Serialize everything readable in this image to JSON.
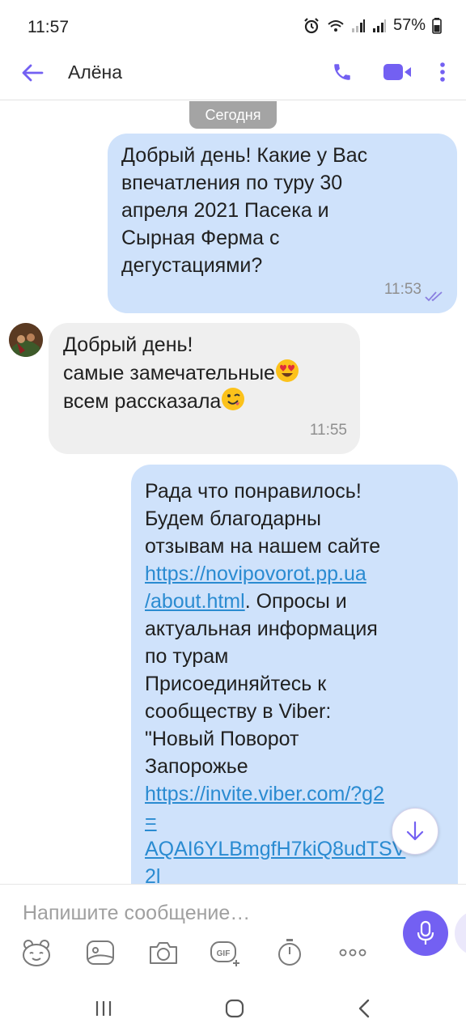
{
  "status_bar": {
    "time": "11:57",
    "battery": "57%",
    "icons": [
      "alarm-icon",
      "wifi-icon",
      "signal-icon",
      "signal-icon",
      "battery-icon"
    ]
  },
  "header": {
    "contact_name": "Алёна",
    "icons": [
      "back-arrow-icon",
      "phone-icon",
      "video-camera-icon",
      "more-vertical-icon"
    ]
  },
  "colors": {
    "accent": "#7360f2",
    "outgoing_bubble": "#cfe2fb",
    "incoming_bubble": "#efefef",
    "link": "#2a8bd1",
    "date_chip": "#a4a4a4"
  },
  "chat": {
    "date_label": "Сегодня",
    "messages": [
      {
        "direction": "outgoing",
        "text": "Добрый день! Какие у Вас\nвпечатления по туру 30\nапреля 2021 Пасека и\nСырная Ферма с\nдегустациями?",
        "time": "11:53",
        "status": "read"
      },
      {
        "direction": "incoming",
        "line1": "Добрый день!",
        "line2": "самые замечательные",
        "line3": "всем рассказала",
        "time": "11:55",
        "emojis": [
          "heart-eyes-emoji",
          "winking-face-emoji"
        ]
      },
      {
        "direction": "outgoing",
        "part1": "Рада что понравилось!\nБудем благодарны\nотзывам на нашем сайте\n",
        "link1": "https://novipovorot.pp.ua\n/about.html",
        "part2": ". Опросы и\nактуальная информация\nпо турам\n Присоединяйтесь к\nсообществу в Viber:\n\"Новый Поворот\nЗапорожье\n",
        "link2": "https://invite.viber.com/?g2\n=\nAQAI6YLBmgfH7kiQ8udTSV\n2l"
      }
    ]
  },
  "composer": {
    "placeholder": "Напишите сообщение…",
    "tools": [
      "sticker-icon",
      "doodle-icon",
      "camera-icon",
      "gif-icon",
      "timer-icon",
      "more-horizontal-icon"
    ],
    "send_icon": "microphone-icon"
  },
  "nav_bar": {
    "buttons": [
      "recent-apps-icon",
      "home-icon",
      "back-icon"
    ]
  }
}
